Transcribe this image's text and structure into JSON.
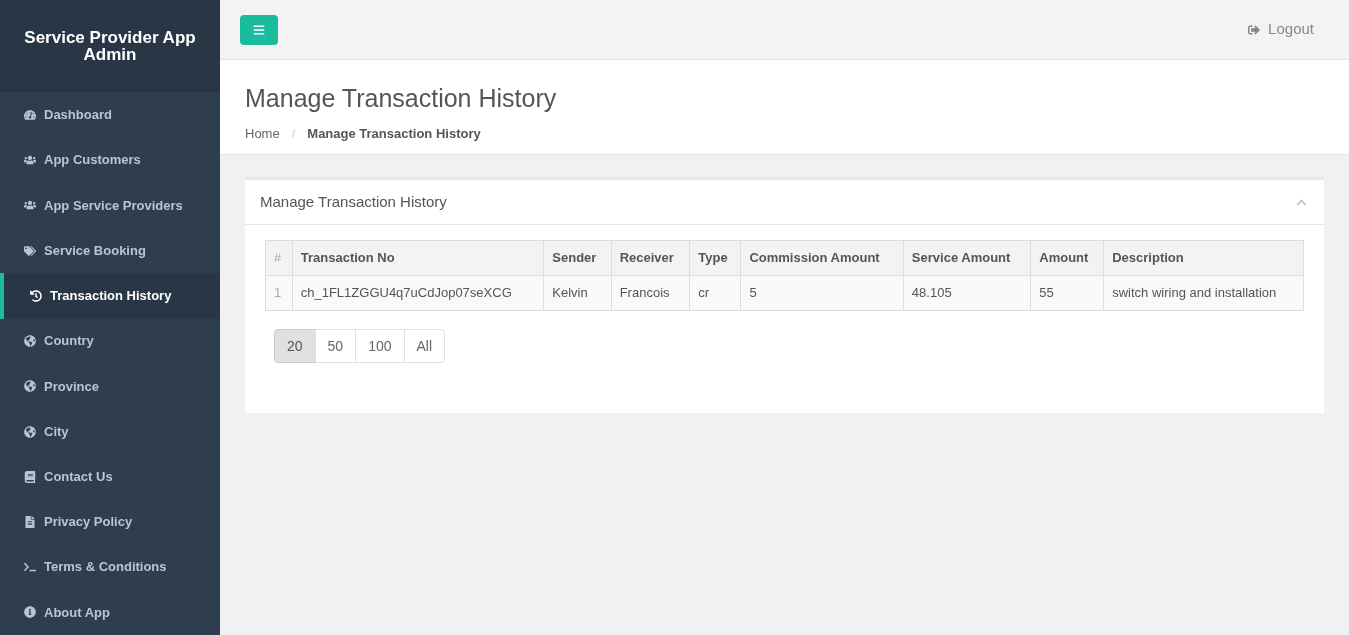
{
  "sidebar": {
    "title": "Service Provider App Admin",
    "items": [
      {
        "label": "Dashboard",
        "selected": false
      },
      {
        "label": "App Customers",
        "selected": false
      },
      {
        "label": "App Service Providers",
        "selected": false
      },
      {
        "label": "Service Booking",
        "selected": false
      },
      {
        "label": "Transaction History",
        "selected": true
      },
      {
        "label": "Country",
        "selected": false
      },
      {
        "label": "Province",
        "selected": false
      },
      {
        "label": "City",
        "selected": false
      },
      {
        "label": "Contact Us",
        "selected": false
      },
      {
        "label": "Privacy Policy",
        "selected": false
      },
      {
        "label": "Terms & Conditions",
        "selected": false
      },
      {
        "label": "About App",
        "selected": false
      }
    ]
  },
  "topbar": {
    "logout": "Logout"
  },
  "page": {
    "title": "Manage Transaction History",
    "breadcrumb": [
      "Home",
      "Manage Transaction History"
    ],
    "breadcrumb_separator": "/"
  },
  "panel": {
    "title": "Manage Transaction History",
    "table": {
      "columns": [
        "#",
        "Transaction No",
        "Sender",
        "Receiver",
        "Type",
        "Commission Amount",
        "Service Amount",
        "Amount",
        "Description"
      ],
      "rows": [
        [
          "1",
          "ch_1FL1ZGGU4q7uCdJop07seXCG",
          "Kelvin",
          "Francois",
          "cr",
          "5",
          "48.105",
          "55",
          "switch wiring and installation"
        ]
      ]
    },
    "page_sizes": [
      {
        "label": "20",
        "selected": true
      },
      {
        "label": "50",
        "selected": false
      },
      {
        "label": "100",
        "selected": false
      },
      {
        "label": "All",
        "selected": false
      }
    ]
  }
}
